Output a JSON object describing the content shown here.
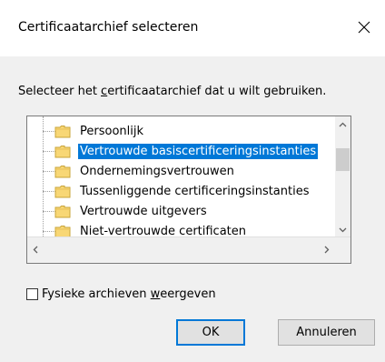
{
  "dialog": {
    "title": "Certificaatarchief selecteren",
    "instruction_pre": "Selecteer het ",
    "instruction_u": "c",
    "instruction_post": "ertificaatarchief dat u wilt gebruiken."
  },
  "tree": {
    "items": [
      {
        "label": "Persoonlijk",
        "selected": false
      },
      {
        "label": "Vertrouwde basiscertificeringsinstanties",
        "selected": true
      },
      {
        "label": "Ondernemingsvertrouwen",
        "selected": false
      },
      {
        "label": "Tussenliggende certificeringsinstanties",
        "selected": false
      },
      {
        "label": "Vertrouwde uitgevers",
        "selected": false
      },
      {
        "label": "Niet-vertrouwde certificaten",
        "selected": false
      }
    ]
  },
  "checkbox": {
    "label_pre": "Fysieke archieven ",
    "label_u": "w",
    "label_post": "eergeven",
    "checked": false
  },
  "buttons": {
    "ok": "OK",
    "cancel": "Annuleren"
  },
  "colors": {
    "selection": "#0078d7",
    "folder": "#f8d775"
  }
}
